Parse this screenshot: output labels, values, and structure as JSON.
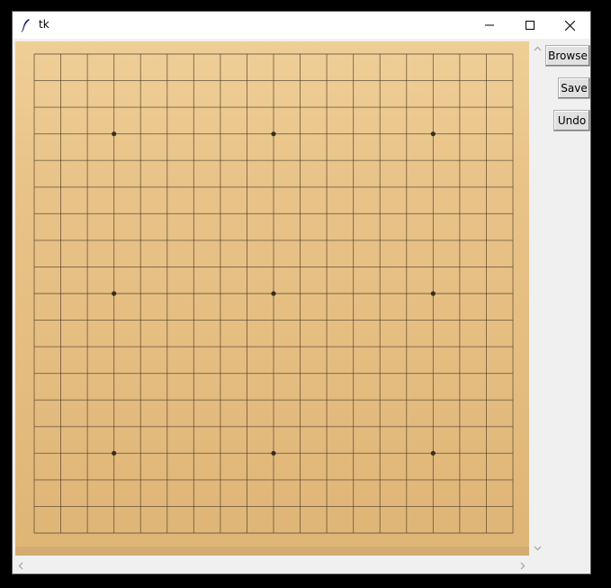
{
  "window": {
    "title": "tk",
    "title_icon": "feather-icon",
    "controls": [
      "minimize-icon",
      "maximize-icon",
      "close-icon"
    ]
  },
  "board": {
    "grid_size": 19,
    "star_points": [
      [
        3,
        3
      ],
      [
        9,
        3
      ],
      [
        15,
        3
      ],
      [
        3,
        9
      ],
      [
        9,
        9
      ],
      [
        15,
        9
      ],
      [
        3,
        15
      ],
      [
        9,
        15
      ],
      [
        15,
        15
      ]
    ],
    "colors": {
      "wood_light": "#efcf97",
      "wood_dark": "#dfb576",
      "line": "#4a3a28"
    }
  },
  "buttons": {
    "browse": "Browse",
    "save": "Save",
    "undo": "Undo"
  },
  "scrollbars": {
    "vertical_icons": [
      "chevron-up-icon",
      "chevron-down-icon"
    ],
    "horizontal_icons": [
      "chevron-left-icon",
      "chevron-right-icon"
    ]
  }
}
